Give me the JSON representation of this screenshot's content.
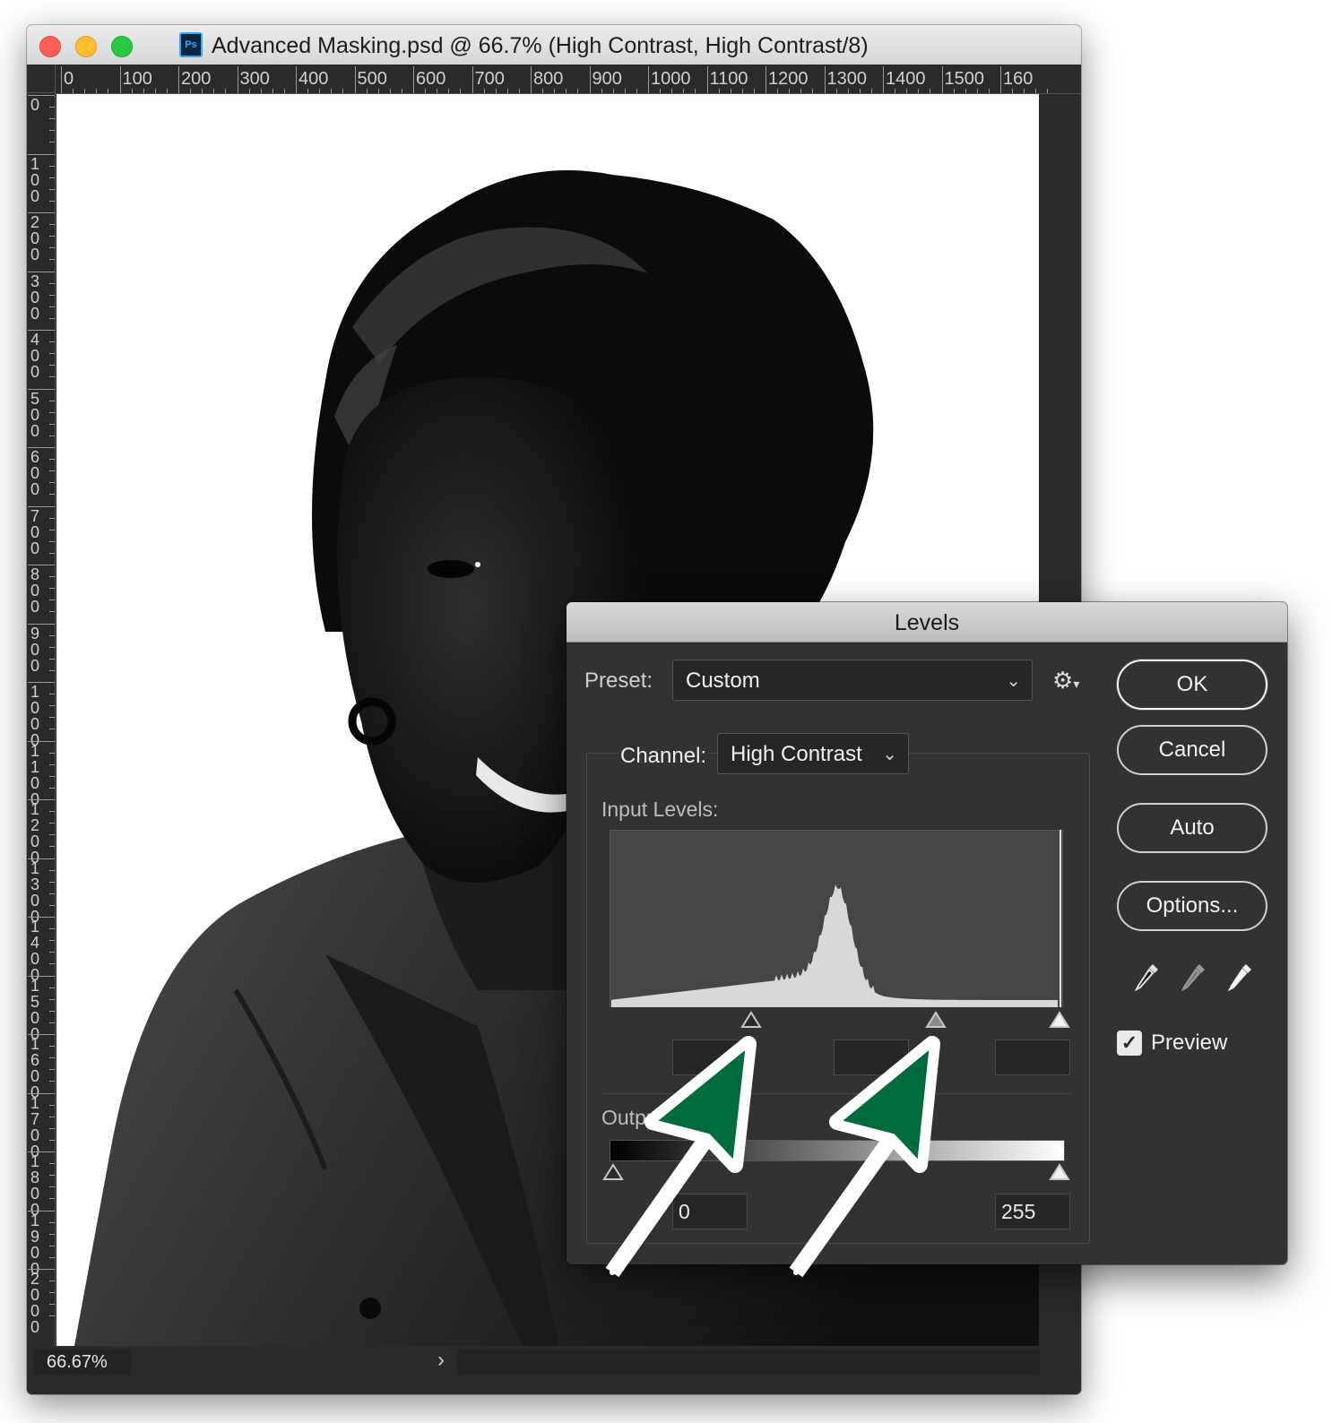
{
  "window": {
    "title": "Advanced Masking.psd @ 66.7% (High Contrast, High Contrast/8)",
    "app_icon": "Ps",
    "ruler_h": [
      "0",
      "100",
      "200",
      "300",
      "400",
      "500",
      "600",
      "700",
      "800",
      "900",
      "1000",
      "1100",
      "1200",
      "1300",
      "1400",
      "1500",
      "160"
    ],
    "ruler_v": [
      "0",
      "1 0 0",
      "2 0 0",
      "3 0 0",
      "4 0 0",
      "5 0 0",
      "6 0 0",
      "7 0 0",
      "8 0 0",
      "9 0 0",
      "1 0 0 0",
      "1 1 0 0",
      "1 2 0 0",
      "1 3 0 0",
      "1 4 0 0",
      "1 5 0 0",
      "1 6 0 0",
      "1 7 0 0",
      "1 8 0 0",
      "1 9 0 0",
      "2 0 0 0"
    ],
    "zoom": "66.67%"
  },
  "dialog": {
    "title": "Levels",
    "preset_label": "Preset:",
    "preset_value": "Custom",
    "channel_label": "Channel:",
    "channel_value": "High Contrast",
    "input_levels_label": "Input Levels:",
    "output_levels_label": "Output Levels:",
    "input_values": [
      "",
      "",
      ""
    ],
    "output_values": [
      "0",
      "255"
    ],
    "buttons": {
      "ok": "OK",
      "cancel": "Cancel",
      "auto": "Auto",
      "options": "Options..."
    },
    "preview_label": "Preview",
    "preview_checked": true,
    "eyedroppers": [
      "black-point-eyedropper-icon",
      "gray-point-eyedropper-icon",
      "white-point-eyedropper-icon"
    ]
  },
  "colors": {
    "annotation_arrow": "#006b3c",
    "dialog_bg": "#323232",
    "window_bg": "#2b2b2b"
  }
}
